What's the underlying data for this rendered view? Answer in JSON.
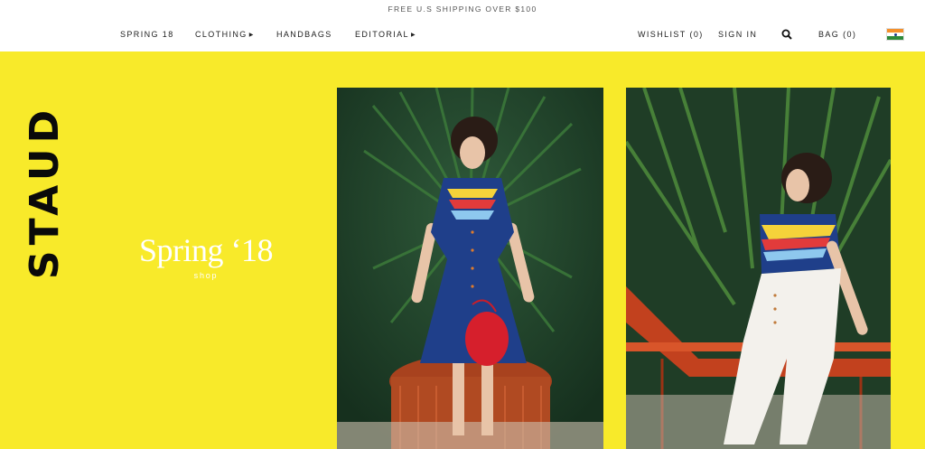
{
  "promo": {
    "text": "FREE U.S SHIPPING OVER $100"
  },
  "nav": {
    "spring": "SPRING 18",
    "clothing": "CLOTHING",
    "handbags": "HANDBAGS",
    "editorial": "EDITORIAL",
    "wishlist": "WISHLIST (0)",
    "signin": "SIGN IN",
    "bag": "BAG (0)",
    "search_icon": "search-icon",
    "flag_icon": "india-flag-icon"
  },
  "hero": {
    "brand": "STAUD",
    "title": "Spring ‘18",
    "shop": "shop",
    "background": "#f8ea2a"
  }
}
